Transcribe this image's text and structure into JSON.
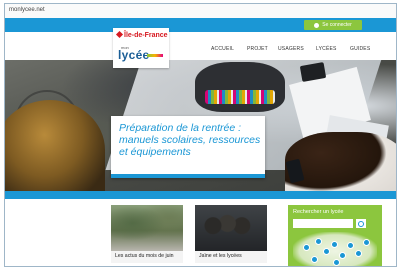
{
  "browser": {
    "url": "monlycee.net"
  },
  "topbar": {
    "connect_label": "Se connecter",
    "accent": "#1b97d5",
    "connect_color": "#8cc63e"
  },
  "logo": {
    "region": "Île-de-France",
    "small_text": "mon",
    "main_text": "lycée"
  },
  "nav": {
    "items": [
      "ACCUEIL",
      "PROJET",
      "USAGERS",
      "LYCÉES",
      "GUIDES"
    ]
  },
  "hero": {
    "headline": "Préparation de la rentrée : manuels scolaires, ressources et équipements"
  },
  "cards": [
    {
      "caption": "Les actus du mois de juin"
    },
    {
      "caption": "Jaïne et les lycées"
    }
  ],
  "search": {
    "title": "Rechercher un lycée",
    "placeholder": "",
    "icon": "search-icon",
    "panel_color": "#8cc63e"
  }
}
